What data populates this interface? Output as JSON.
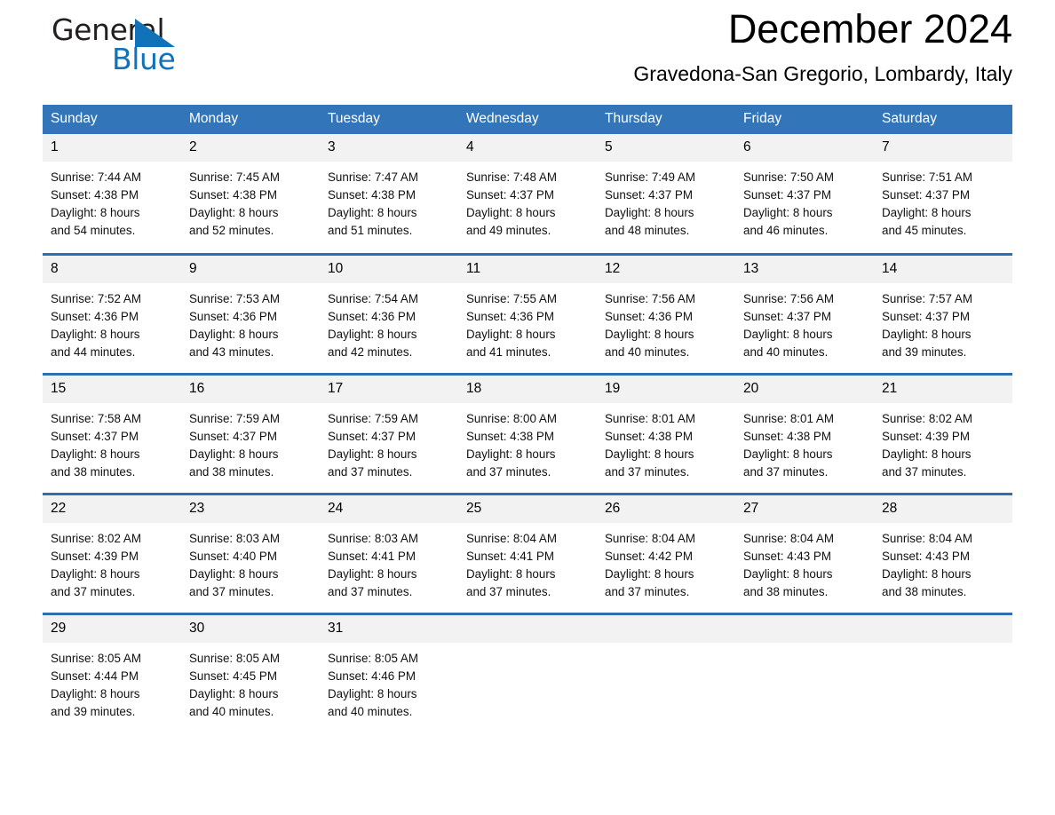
{
  "brand": {
    "name_dark": "General",
    "name_light": "Blue",
    "flag_color": "#1272b8"
  },
  "header": {
    "title": "December 2024",
    "subtitle": "Gravedona-San Gregorio, Lombardy, Italy"
  },
  "theme": {
    "header_bg": "#3275b8",
    "row_divider": "#2f6fad",
    "daynum_bg": "#f2f2f2"
  },
  "weekday_headers": [
    "Sunday",
    "Monday",
    "Tuesday",
    "Wednesday",
    "Thursday",
    "Friday",
    "Saturday"
  ],
  "labels": {
    "sunrise_prefix": "Sunrise:",
    "sunset_prefix": "Sunset:",
    "daylight_prefix": "Daylight:"
  },
  "weeks": [
    [
      {
        "day": "1",
        "sunrise": "Sunrise: 7:44 AM",
        "sunset": "Sunset: 4:38 PM",
        "daylight_1": "Daylight: 8 hours",
        "daylight_2": "and 54 minutes."
      },
      {
        "day": "2",
        "sunrise": "Sunrise: 7:45 AM",
        "sunset": "Sunset: 4:38 PM",
        "daylight_1": "Daylight: 8 hours",
        "daylight_2": "and 52 minutes."
      },
      {
        "day": "3",
        "sunrise": "Sunrise: 7:47 AM",
        "sunset": "Sunset: 4:38 PM",
        "daylight_1": "Daylight: 8 hours",
        "daylight_2": "and 51 minutes."
      },
      {
        "day": "4",
        "sunrise": "Sunrise: 7:48 AM",
        "sunset": "Sunset: 4:37 PM",
        "daylight_1": "Daylight: 8 hours",
        "daylight_2": "and 49 minutes."
      },
      {
        "day": "5",
        "sunrise": "Sunrise: 7:49 AM",
        "sunset": "Sunset: 4:37 PM",
        "daylight_1": "Daylight: 8 hours",
        "daylight_2": "and 48 minutes."
      },
      {
        "day": "6",
        "sunrise": "Sunrise: 7:50 AM",
        "sunset": "Sunset: 4:37 PM",
        "daylight_1": "Daylight: 8 hours",
        "daylight_2": "and 46 minutes."
      },
      {
        "day": "7",
        "sunrise": "Sunrise: 7:51 AM",
        "sunset": "Sunset: 4:37 PM",
        "daylight_1": "Daylight: 8 hours",
        "daylight_2": "and 45 minutes."
      }
    ],
    [
      {
        "day": "8",
        "sunrise": "Sunrise: 7:52 AM",
        "sunset": "Sunset: 4:36 PM",
        "daylight_1": "Daylight: 8 hours",
        "daylight_2": "and 44 minutes."
      },
      {
        "day": "9",
        "sunrise": "Sunrise: 7:53 AM",
        "sunset": "Sunset: 4:36 PM",
        "daylight_1": "Daylight: 8 hours",
        "daylight_2": "and 43 minutes."
      },
      {
        "day": "10",
        "sunrise": "Sunrise: 7:54 AM",
        "sunset": "Sunset: 4:36 PM",
        "daylight_1": "Daylight: 8 hours",
        "daylight_2": "and 42 minutes."
      },
      {
        "day": "11",
        "sunrise": "Sunrise: 7:55 AM",
        "sunset": "Sunset: 4:36 PM",
        "daylight_1": "Daylight: 8 hours",
        "daylight_2": "and 41 minutes."
      },
      {
        "day": "12",
        "sunrise": "Sunrise: 7:56 AM",
        "sunset": "Sunset: 4:36 PM",
        "daylight_1": "Daylight: 8 hours",
        "daylight_2": "and 40 minutes."
      },
      {
        "day": "13",
        "sunrise": "Sunrise: 7:56 AM",
        "sunset": "Sunset: 4:37 PM",
        "daylight_1": "Daylight: 8 hours",
        "daylight_2": "and 40 minutes."
      },
      {
        "day": "14",
        "sunrise": "Sunrise: 7:57 AM",
        "sunset": "Sunset: 4:37 PM",
        "daylight_1": "Daylight: 8 hours",
        "daylight_2": "and 39 minutes."
      }
    ],
    [
      {
        "day": "15",
        "sunrise": "Sunrise: 7:58 AM",
        "sunset": "Sunset: 4:37 PM",
        "daylight_1": "Daylight: 8 hours",
        "daylight_2": "and 38 minutes."
      },
      {
        "day": "16",
        "sunrise": "Sunrise: 7:59 AM",
        "sunset": "Sunset: 4:37 PM",
        "daylight_1": "Daylight: 8 hours",
        "daylight_2": "and 38 minutes."
      },
      {
        "day": "17",
        "sunrise": "Sunrise: 7:59 AM",
        "sunset": "Sunset: 4:37 PM",
        "daylight_1": "Daylight: 8 hours",
        "daylight_2": "and 37 minutes."
      },
      {
        "day": "18",
        "sunrise": "Sunrise: 8:00 AM",
        "sunset": "Sunset: 4:38 PM",
        "daylight_1": "Daylight: 8 hours",
        "daylight_2": "and 37 minutes."
      },
      {
        "day": "19",
        "sunrise": "Sunrise: 8:01 AM",
        "sunset": "Sunset: 4:38 PM",
        "daylight_1": "Daylight: 8 hours",
        "daylight_2": "and 37 minutes."
      },
      {
        "day": "20",
        "sunrise": "Sunrise: 8:01 AM",
        "sunset": "Sunset: 4:38 PM",
        "daylight_1": "Daylight: 8 hours",
        "daylight_2": "and 37 minutes."
      },
      {
        "day": "21",
        "sunrise": "Sunrise: 8:02 AM",
        "sunset": "Sunset: 4:39 PM",
        "daylight_1": "Daylight: 8 hours",
        "daylight_2": "and 37 minutes."
      }
    ],
    [
      {
        "day": "22",
        "sunrise": "Sunrise: 8:02 AM",
        "sunset": "Sunset: 4:39 PM",
        "daylight_1": "Daylight: 8 hours",
        "daylight_2": "and 37 minutes."
      },
      {
        "day": "23",
        "sunrise": "Sunrise: 8:03 AM",
        "sunset": "Sunset: 4:40 PM",
        "daylight_1": "Daylight: 8 hours",
        "daylight_2": "and 37 minutes."
      },
      {
        "day": "24",
        "sunrise": "Sunrise: 8:03 AM",
        "sunset": "Sunset: 4:41 PM",
        "daylight_1": "Daylight: 8 hours",
        "daylight_2": "and 37 minutes."
      },
      {
        "day": "25",
        "sunrise": "Sunrise: 8:04 AM",
        "sunset": "Sunset: 4:41 PM",
        "daylight_1": "Daylight: 8 hours",
        "daylight_2": "and 37 minutes."
      },
      {
        "day": "26",
        "sunrise": "Sunrise: 8:04 AM",
        "sunset": "Sunset: 4:42 PM",
        "daylight_1": "Daylight: 8 hours",
        "daylight_2": "and 37 minutes."
      },
      {
        "day": "27",
        "sunrise": "Sunrise: 8:04 AM",
        "sunset": "Sunset: 4:43 PM",
        "daylight_1": "Daylight: 8 hours",
        "daylight_2": "and 38 minutes."
      },
      {
        "day": "28",
        "sunrise": "Sunrise: 8:04 AM",
        "sunset": "Sunset: 4:43 PM",
        "daylight_1": "Daylight: 8 hours",
        "daylight_2": "and 38 minutes."
      }
    ],
    [
      {
        "day": "29",
        "sunrise": "Sunrise: 8:05 AM",
        "sunset": "Sunset: 4:44 PM",
        "daylight_1": "Daylight: 8 hours",
        "daylight_2": "and 39 minutes."
      },
      {
        "day": "30",
        "sunrise": "Sunrise: 8:05 AM",
        "sunset": "Sunset: 4:45 PM",
        "daylight_1": "Daylight: 8 hours",
        "daylight_2": "and 40 minutes."
      },
      {
        "day": "31",
        "sunrise": "Sunrise: 8:05 AM",
        "sunset": "Sunset: 4:46 PM",
        "daylight_1": "Daylight: 8 hours",
        "daylight_2": "and 40 minutes."
      },
      {
        "day": "",
        "sunrise": "",
        "sunset": "",
        "daylight_1": "",
        "daylight_2": ""
      },
      {
        "day": "",
        "sunrise": "",
        "sunset": "",
        "daylight_1": "",
        "daylight_2": ""
      },
      {
        "day": "",
        "sunrise": "",
        "sunset": "",
        "daylight_1": "",
        "daylight_2": ""
      },
      {
        "day": "",
        "sunrise": "",
        "sunset": "",
        "daylight_1": "",
        "daylight_2": ""
      }
    ]
  ]
}
